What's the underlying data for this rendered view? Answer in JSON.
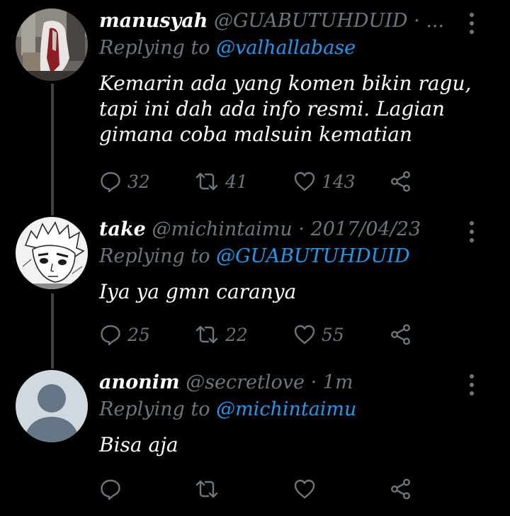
{
  "tweets": [
    {
      "name": "manusyah",
      "handle": "@GUABUTUHDUID",
      "meta": "· ...",
      "reply_prefix": "Replying to",
      "reply_to": "@valhallabase",
      "body": [
        "Kemarin ada yang komen bikin ragu,",
        "tapi ini dah ada info resmi. Lagian",
        "gimana coba malsuin kematian"
      ],
      "replies": "32",
      "retweets": "41",
      "likes": "143"
    },
    {
      "name": "take",
      "handle": "@michintaimu",
      "meta": "· 2017/04/23",
      "reply_prefix": "Replying to",
      "reply_to": "@GUABUTUHDUID",
      "body": [
        "Iya ya gmn caranya"
      ],
      "replies": "25",
      "retweets": "22",
      "likes": "55"
    },
    {
      "name": "anonim",
      "handle": "@secretlove",
      "meta": "· 1m",
      "reply_prefix": "Replying to",
      "reply_to": "@michintaimu",
      "body": [
        "Bisa aja"
      ]
    }
  ],
  "icons": {
    "reply": "reply-icon",
    "retweet": "retweet-icon",
    "like": "heart-icon",
    "share": "share-icon",
    "more": "more-icon"
  },
  "colors": {
    "background": "#000000",
    "muted": "#6e767d",
    "link": "#1d9bf0",
    "thread_line": "#3d4148"
  }
}
